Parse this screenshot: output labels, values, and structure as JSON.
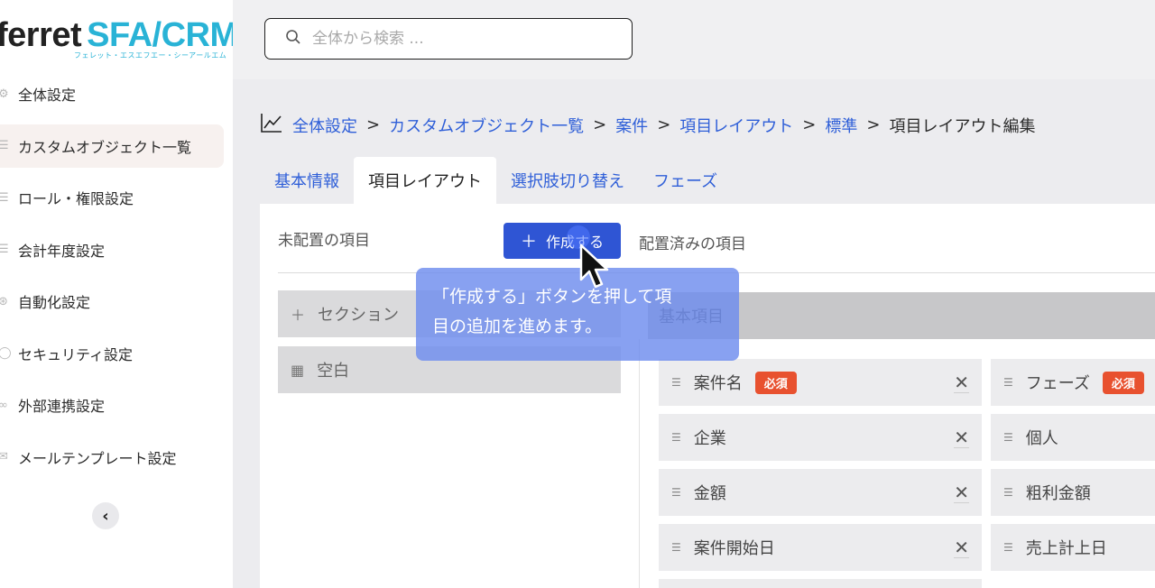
{
  "brand": {
    "name_left": "ferret",
    "name_right": "SFA/CRM",
    "tagline": "フェレット・エスエフエー・シーアールエム"
  },
  "sidebar": {
    "items": [
      {
        "label": "全体設定",
        "icon": "gear-icon",
        "active": false
      },
      {
        "label": "カスタムオブジェクト一覧",
        "icon": "database-icon",
        "active": true
      },
      {
        "label": "ロール・権限設定",
        "icon": "database-icon",
        "active": false
      },
      {
        "label": "会計年度設定",
        "icon": "database-icon",
        "active": false
      },
      {
        "label": "自動化設定",
        "icon": "automation-icon",
        "active": false
      },
      {
        "label": "セキュリティ設定",
        "icon": "shield-icon",
        "active": false
      },
      {
        "label": "外部連携設定",
        "icon": "link-icon",
        "active": false
      },
      {
        "label": "メールテンプレート設定",
        "icon": "mail-icon",
        "active": false
      }
    ],
    "collapse_icon": "chevron-left-icon"
  },
  "search": {
    "placeholder": "全体から検索 ..."
  },
  "breadcrumb": {
    "links": [
      "全体設定",
      "カスタムオブジェクト一覧",
      "案件",
      "項目レイアウト",
      "標準"
    ],
    "current": "項目レイアウト編集",
    "separator": ">"
  },
  "tabs": [
    {
      "label": "基本情報",
      "active": false
    },
    {
      "label": "項目レイアウト",
      "active": true
    },
    {
      "label": "選択肢切り替え",
      "active": false
    },
    {
      "label": "フェーズ",
      "active": false
    }
  ],
  "layout": {
    "unplaced_title": "未配置の項目",
    "create_button": "作成する",
    "placed_title": "配置済みの項目",
    "unplaced_items": [
      {
        "label": "セクション",
        "icon": "plus-icon"
      },
      {
        "label": "空白",
        "icon": "grid-icon"
      }
    ],
    "section_title": "基本項目",
    "required_label": "必須",
    "fields_left": [
      {
        "label": "案件名",
        "required": true
      },
      {
        "label": "企業",
        "required": false
      },
      {
        "label": "金額",
        "required": false
      },
      {
        "label": "案件開始日",
        "required": false
      }
    ],
    "fields_right": [
      {
        "label": "フェーズ",
        "required": true
      },
      {
        "label": "個人",
        "required": false
      },
      {
        "label": "粗利金額",
        "required": false
      },
      {
        "label": "売上計上日",
        "required": false
      }
    ]
  },
  "tooltip": {
    "line1": "「作成する」ボタンを押して項",
    "line2": "目の追加を進めます。"
  },
  "colors": {
    "accent": "#2f55d4",
    "link": "#2f5fd8",
    "required": "#e8512f",
    "brand": "#29b3d6"
  }
}
